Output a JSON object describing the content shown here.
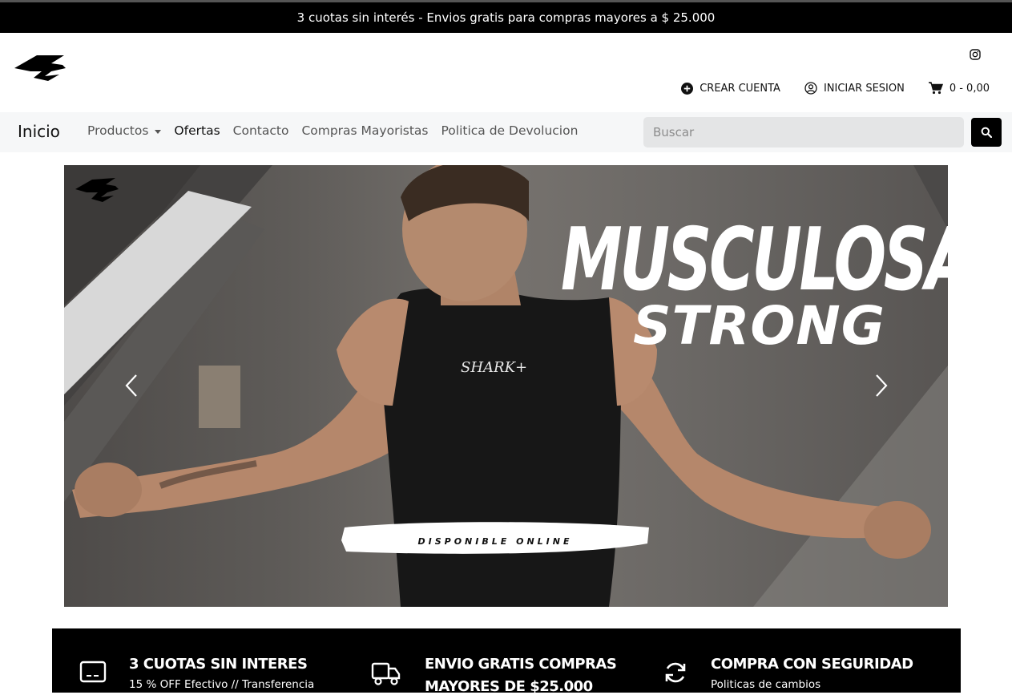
{
  "topbar": {
    "text": "3 cuotas sin interés - Envios gratis para compras mayores a $ 25.000"
  },
  "header": {
    "logo_icon": "shark-logo",
    "social_icon": "instagram-icon",
    "create_account": "CREAR CUENTA",
    "login": "INICIAR SESION",
    "cart": "0 - 0,00"
  },
  "nav": {
    "home": "Inicio",
    "items": [
      {
        "label": "Productos",
        "dropdown": true
      },
      {
        "label": "Ofertas"
      },
      {
        "label": "Contacto"
      },
      {
        "label": "Compras Mayoristas"
      },
      {
        "label": "Politica de Devolucion"
      }
    ],
    "search_placeholder": "Buscar"
  },
  "banner": {
    "title_line1": "MUSCULOSA",
    "title_line2": "STRONG",
    "shirt_text": "SHARK+",
    "cta": "DISPONIBLE ONLINE"
  },
  "features": [
    {
      "icon": "credit-card-icon",
      "title": "3 CUOTAS SIN INTERES",
      "subtitle": "15 % OFF Efectivo // Transferencia"
    },
    {
      "icon": "truck-icon",
      "title": "ENVIO GRATIS COMPRAS",
      "title2": "MAYORES DE $25.000"
    },
    {
      "icon": "refresh-icon",
      "title": "COMPRA CON SEGURIDAD",
      "subtitle": "Politicas de cambios"
    }
  ],
  "colors": {
    "topbar": "#000000",
    "navbar": "#f6f7f8",
    "search_field": "#e4e5e6",
    "accent": "#000000"
  }
}
